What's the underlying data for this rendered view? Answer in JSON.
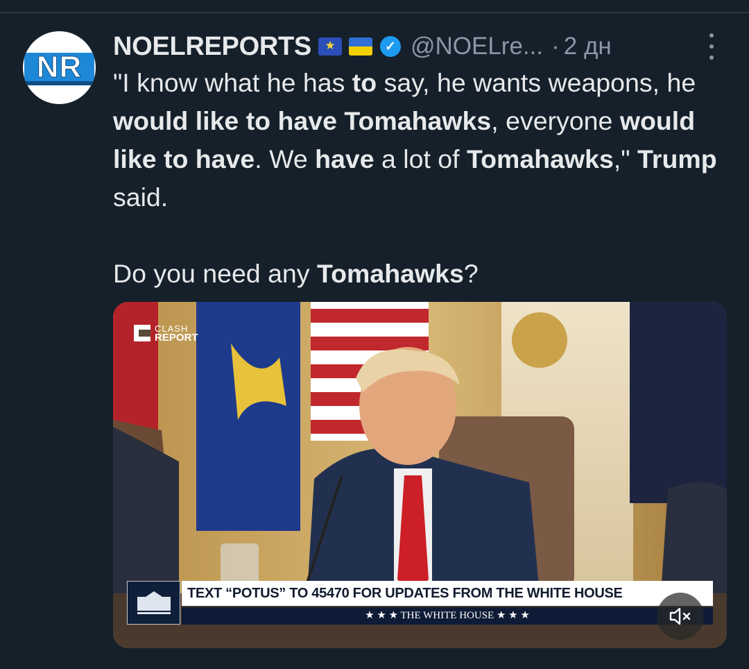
{
  "author": {
    "avatar_text": "NR",
    "name": "NOELREPORTS",
    "badges": [
      "eu-flag-icon",
      "ukraine-flag-icon",
      "verified-badge-icon"
    ],
    "handle": "@NOELre...",
    "separator": "·",
    "time": "2 дн"
  },
  "tweet": {
    "quote": [
      {
        "t": "\"I know what he has ",
        "b": false
      },
      {
        "t": "to",
        "b": true
      },
      {
        "t": " say, he wants weapons, he ",
        "b": false
      },
      {
        "t": "would like to have Tomahawks",
        "b": true
      },
      {
        "t": ", everyone ",
        "b": false
      },
      {
        "t": "would like to have",
        "b": true
      },
      {
        "t": ". We ",
        "b": false
      },
      {
        "t": "have",
        "b": true
      },
      {
        "t": " a lot of ",
        "b": false
      },
      {
        "t": "Tomahawks",
        "b": true
      },
      {
        "t": ",\" ",
        "b": false
      },
      {
        "t": "Trump",
        "b": true
      },
      {
        "t": " said.",
        "b": false
      }
    ],
    "question": [
      {
        "t": "Do you need any ",
        "b": false
      },
      {
        "t": "Tomahawks",
        "b": true
      },
      {
        "t": "?",
        "b": false
      }
    ]
  },
  "media": {
    "watermark_line1": "CLASH",
    "watermark_line2": "REPORT",
    "lower_third": "TEXT “POTUS” TO 45470 FOR UPDATES FROM THE WHITE HOUSE",
    "lower_third_sub": "★ ★ ★   THE WHITE HOUSE   ★ ★ ★",
    "mute_icon": "speaker-muted-icon"
  },
  "colors": {
    "background": "#15202b",
    "text": "#e7e9ea",
    "secondary_text": "#8b98a5",
    "verified": "#1d9bf0"
  }
}
